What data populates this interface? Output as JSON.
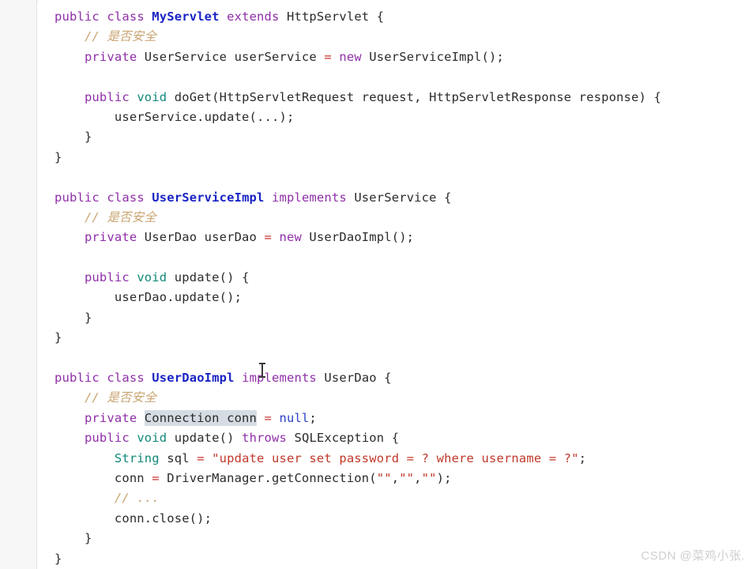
{
  "editor": {
    "language": "Java",
    "theme_background": "#ffffff",
    "gutter_background": "#f7f7f7",
    "colors": {
      "keyword": "#8f2fa8",
      "class_name": "#1a24c4",
      "plain_text": "#2b2b2b",
      "comment": "#c9a470",
      "primitive_type": "#11897a",
      "string_literal": "#c0392b",
      "operator": "#cc3333",
      "null_keyword": "#2b3fc9",
      "selection_highlight": "#d5dce3",
      "watermark": "#cfcfcf"
    },
    "selection": {
      "text": "Connection conn",
      "line": 21
    },
    "lines": [
      {
        "indent": 0,
        "tokens": [
          {
            "t": "public",
            "c": "kw"
          },
          {
            "t": " ",
            "c": "plain"
          },
          {
            "t": "class",
            "c": "kw"
          },
          {
            "t": " ",
            "c": "plain"
          },
          {
            "t": "MyServlet",
            "c": "type"
          },
          {
            "t": " ",
            "c": "plain"
          },
          {
            "t": "extends",
            "c": "kw"
          },
          {
            "t": " ",
            "c": "plain"
          },
          {
            "t": "HttpServlet",
            "c": "plain"
          },
          {
            "t": " {",
            "c": "plain"
          }
        ]
      },
      {
        "indent": 1,
        "tokens": [
          {
            "t": "// 是否安全",
            "c": "cmt"
          }
        ]
      },
      {
        "indent": 1,
        "tokens": [
          {
            "t": "private",
            "c": "kw"
          },
          {
            "t": " ",
            "c": "plain"
          },
          {
            "t": "UserService userService ",
            "c": "plain"
          },
          {
            "t": "=",
            "c": "op"
          },
          {
            "t": " ",
            "c": "plain"
          },
          {
            "t": "new",
            "c": "kw"
          },
          {
            "t": " ",
            "c": "plain"
          },
          {
            "t": "UserServiceImpl();",
            "c": "plain"
          }
        ]
      },
      {
        "indent": 0,
        "tokens": []
      },
      {
        "indent": 1,
        "tokens": [
          {
            "t": "public",
            "c": "kw"
          },
          {
            "t": " ",
            "c": "plain"
          },
          {
            "t": "void",
            "c": "vd"
          },
          {
            "t": " ",
            "c": "plain"
          },
          {
            "t": "doGet(HttpServletRequest request, HttpServletResponse response) {",
            "c": "plain"
          }
        ]
      },
      {
        "indent": 2,
        "tokens": [
          {
            "t": "userService.update(...);",
            "c": "plain"
          }
        ]
      },
      {
        "indent": 1,
        "tokens": [
          {
            "t": "}",
            "c": "plain"
          }
        ]
      },
      {
        "indent": 0,
        "tokens": [
          {
            "t": "}",
            "c": "plain"
          }
        ]
      },
      {
        "indent": 0,
        "tokens": []
      },
      {
        "indent": 0,
        "tokens": [
          {
            "t": "public",
            "c": "kw"
          },
          {
            "t": " ",
            "c": "plain"
          },
          {
            "t": "class",
            "c": "kw"
          },
          {
            "t": " ",
            "c": "plain"
          },
          {
            "t": "UserServiceImpl",
            "c": "type"
          },
          {
            "t": " ",
            "c": "plain"
          },
          {
            "t": "implements",
            "c": "kw"
          },
          {
            "t": " ",
            "c": "plain"
          },
          {
            "t": "UserService",
            "c": "plain"
          },
          {
            "t": " {",
            "c": "plain"
          }
        ]
      },
      {
        "indent": 1,
        "tokens": [
          {
            "t": "// 是否安全",
            "c": "cmt"
          }
        ]
      },
      {
        "indent": 1,
        "tokens": [
          {
            "t": "private",
            "c": "kw"
          },
          {
            "t": " ",
            "c": "plain"
          },
          {
            "t": "UserDao userDao ",
            "c": "plain"
          },
          {
            "t": "=",
            "c": "op"
          },
          {
            "t": " ",
            "c": "plain"
          },
          {
            "t": "new",
            "c": "kw"
          },
          {
            "t": " ",
            "c": "plain"
          },
          {
            "t": "UserDaoImpl();",
            "c": "plain"
          }
        ]
      },
      {
        "indent": 0,
        "tokens": []
      },
      {
        "indent": 1,
        "tokens": [
          {
            "t": "public",
            "c": "kw"
          },
          {
            "t": " ",
            "c": "plain"
          },
          {
            "t": "void",
            "c": "vd"
          },
          {
            "t": " ",
            "c": "plain"
          },
          {
            "t": "update() {",
            "c": "plain"
          }
        ]
      },
      {
        "indent": 2,
        "tokens": [
          {
            "t": "userDao.update();",
            "c": "plain"
          }
        ]
      },
      {
        "indent": 1,
        "tokens": [
          {
            "t": "}",
            "c": "plain"
          }
        ]
      },
      {
        "indent": 0,
        "tokens": [
          {
            "t": "}",
            "c": "plain"
          }
        ]
      },
      {
        "indent": 0,
        "tokens": []
      },
      {
        "indent": 0,
        "tokens": [
          {
            "t": "public",
            "c": "kw"
          },
          {
            "t": " ",
            "c": "plain"
          },
          {
            "t": "class",
            "c": "kw"
          },
          {
            "t": " ",
            "c": "plain"
          },
          {
            "t": "UserDaoImpl",
            "c": "type"
          },
          {
            "t": " ",
            "c": "plain"
          },
          {
            "t": "implements",
            "c": "kw"
          },
          {
            "t": " ",
            "c": "plain"
          },
          {
            "t": "UserDao",
            "c": "plain"
          },
          {
            "t": " {",
            "c": "plain"
          }
        ]
      },
      {
        "indent": 1,
        "tokens": [
          {
            "t": "// 是否安全",
            "c": "cmt"
          }
        ]
      },
      {
        "indent": 1,
        "tokens": [
          {
            "t": "private",
            "c": "kw"
          },
          {
            "t": " ",
            "c": "plain"
          },
          {
            "t": "Connection conn",
            "c": "plain",
            "hl": true
          },
          {
            "t": " ",
            "c": "plain"
          },
          {
            "t": "=",
            "c": "op"
          },
          {
            "t": " ",
            "c": "plain"
          },
          {
            "t": "null",
            "c": "nul"
          },
          {
            "t": ";",
            "c": "plain"
          }
        ]
      },
      {
        "indent": 1,
        "tokens": [
          {
            "t": "public",
            "c": "kw"
          },
          {
            "t": " ",
            "c": "plain"
          },
          {
            "t": "void",
            "c": "vd"
          },
          {
            "t": " ",
            "c": "plain"
          },
          {
            "t": "update() ",
            "c": "plain"
          },
          {
            "t": "throws",
            "c": "kw"
          },
          {
            "t": " ",
            "c": "plain"
          },
          {
            "t": "SQLException {",
            "c": "plain"
          }
        ]
      },
      {
        "indent": 2,
        "tokens": [
          {
            "t": "String",
            "c": "vd"
          },
          {
            "t": " sql ",
            "c": "plain"
          },
          {
            "t": "=",
            "c": "op"
          },
          {
            "t": " ",
            "c": "plain"
          },
          {
            "t": "\"update user set password = ? where username = ?\"",
            "c": "str"
          },
          {
            "t": ";",
            "c": "plain"
          }
        ]
      },
      {
        "indent": 2,
        "tokens": [
          {
            "t": "conn ",
            "c": "plain"
          },
          {
            "t": "=",
            "c": "op"
          },
          {
            "t": " DriverManager.getConnection(",
            "c": "plain"
          },
          {
            "t": "\"\"",
            "c": "str"
          },
          {
            "t": ",",
            "c": "plain"
          },
          {
            "t": "\"\"",
            "c": "str"
          },
          {
            "t": ",",
            "c": "plain"
          },
          {
            "t": "\"\"",
            "c": "str"
          },
          {
            "t": ");",
            "c": "plain"
          }
        ]
      },
      {
        "indent": 2,
        "tokens": [
          {
            "t": "// ...",
            "c": "cmt"
          }
        ]
      },
      {
        "indent": 2,
        "tokens": [
          {
            "t": "conn.close();",
            "c": "plain"
          }
        ]
      },
      {
        "indent": 1,
        "tokens": [
          {
            "t": "}",
            "c": "plain"
          }
        ]
      },
      {
        "indent": 0,
        "tokens": [
          {
            "t": "}",
            "c": "plain"
          }
        ]
      }
    ]
  },
  "watermark": {
    "text": "CSDN @菜鸡小张."
  }
}
